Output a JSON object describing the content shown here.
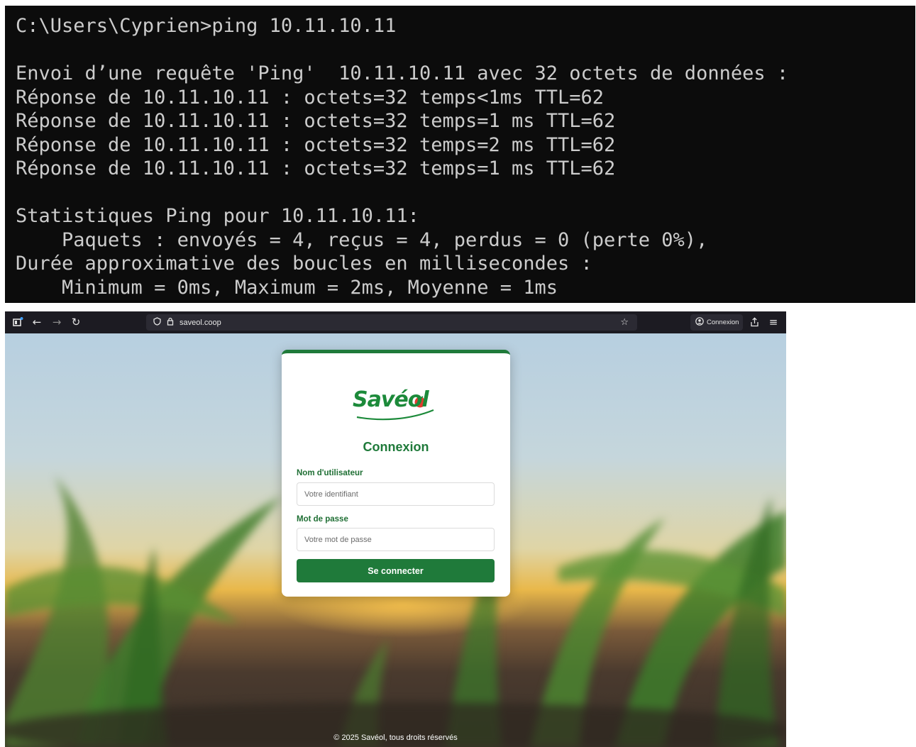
{
  "terminal": {
    "lines": [
      "C:\\Users\\Cyprien>ping 10.11.10.11",
      "",
      "Envoi d’une requête 'Ping'  10.11.10.11 avec 32 octets de données :",
      "Réponse de 10.11.10.11 : octets=32 temps<1ms TTL=62",
      "Réponse de 10.11.10.11 : octets=32 temps=1 ms TTL=62",
      "Réponse de 10.11.10.11 : octets=32 temps=2 ms TTL=62",
      "Réponse de 10.11.10.11 : octets=32 temps=1 ms TTL=62",
      "",
      "Statistiques Ping pour 10.11.10.11:",
      "    Paquets : envoyés = 4, reçus = 4, perdus = 0 (perte 0%),",
      "Durée approximative des boucles en millisecondes :",
      "    Minimum = 0ms, Maximum = 2ms, Moyenne = 1ms"
    ]
  },
  "browser": {
    "url": "saveol.coop",
    "account_label": "Connexion",
    "icons": [
      "tab-icon",
      "back-icon",
      "forward-icon",
      "reload-icon",
      "shield-icon",
      "lock-icon",
      "star-icon",
      "account-icon",
      "share-icon",
      "menu-icon"
    ]
  },
  "login": {
    "logo_text": "Savéol",
    "title": "Connexion",
    "username_label": "Nom d'utilisateur",
    "username_placeholder": "Votre identifiant",
    "password_label": "Mot de passe",
    "password_placeholder": "Votre mot de passe",
    "submit_label": "Se connecter"
  },
  "footer": "© 2025 Savéol, tous droits réservés",
  "colors": {
    "brand_green": "#1f7a3a",
    "terminal_bg": "#0c0c0c",
    "terminal_fg": "#cccccc",
    "browser_chrome": "#1c1b22"
  }
}
